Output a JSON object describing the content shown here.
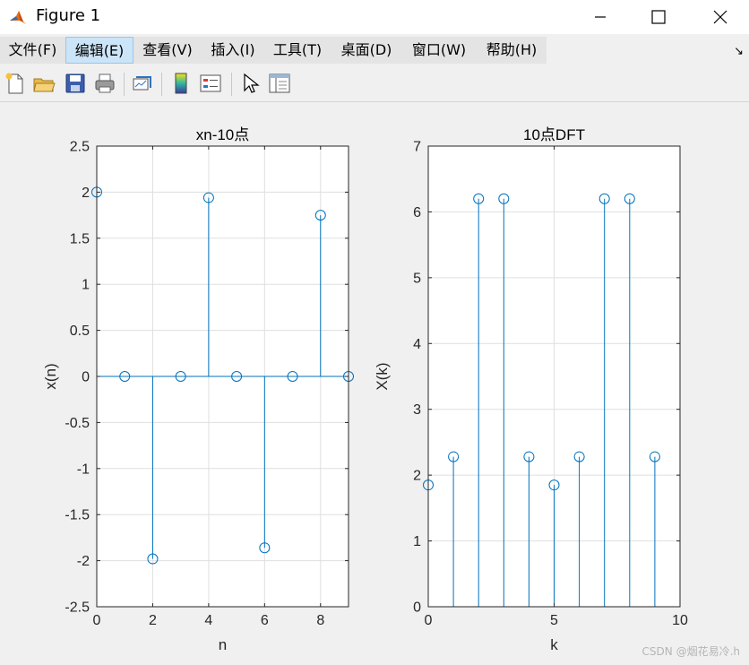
{
  "window": {
    "title": "Figure 1"
  },
  "menu": [
    {
      "label": "文件(F)"
    },
    {
      "label": "编辑(E)"
    },
    {
      "label": "查看(V)"
    },
    {
      "label": "插入(I)"
    },
    {
      "label": "工具(T)"
    },
    {
      "label": "桌面(D)"
    },
    {
      "label": "窗口(W)"
    },
    {
      "label": "帮助(H)"
    }
  ],
  "toolbar": {
    "icons": [
      "new-figure-icon",
      "open-file-icon",
      "save-icon",
      "print-icon",
      "link-plot-icon",
      "colorbar-icon",
      "legend-icon",
      "pointer-icon",
      "property-editor-icon"
    ]
  },
  "chart_data": [
    {
      "type": "stem",
      "title": "xn-10点",
      "xlabel": "n",
      "ylabel": "x(n)",
      "xlim": [
        0,
        9
      ],
      "ylim": [
        -2.5,
        2.5
      ],
      "xticks": [
        0,
        2,
        4,
        6,
        8
      ],
      "yticks": [
        -2.5,
        -2,
        -1.5,
        -1,
        -0.5,
        0,
        0.5,
        1,
        1.5,
        2,
        2.5
      ],
      "grid": true,
      "color": "#0072bd",
      "x": [
        0,
        1,
        2,
        3,
        4,
        5,
        6,
        7,
        8,
        9
      ],
      "y": [
        2,
        0,
        -1.98,
        0,
        1.94,
        0,
        -1.86,
        0,
        1.75,
        0
      ]
    },
    {
      "type": "stem",
      "title": "10点DFT",
      "xlabel": "k",
      "ylabel": "X(k)",
      "xlim": [
        0,
        10
      ],
      "ylim": [
        0,
        7
      ],
      "xticks": [
        0,
        5,
        10
      ],
      "yticks": [
        0,
        1,
        2,
        3,
        4,
        5,
        6,
        7
      ],
      "grid": true,
      "color": "#0072bd",
      "x": [
        0,
        1,
        2,
        3,
        4,
        5,
        6,
        7,
        8,
        9
      ],
      "y": [
        1.85,
        2.28,
        6.2,
        6.2,
        2.28,
        1.85,
        2.28,
        6.2,
        6.2,
        2.28
      ]
    }
  ],
  "watermark": "CSDN @烟花易冷.h"
}
